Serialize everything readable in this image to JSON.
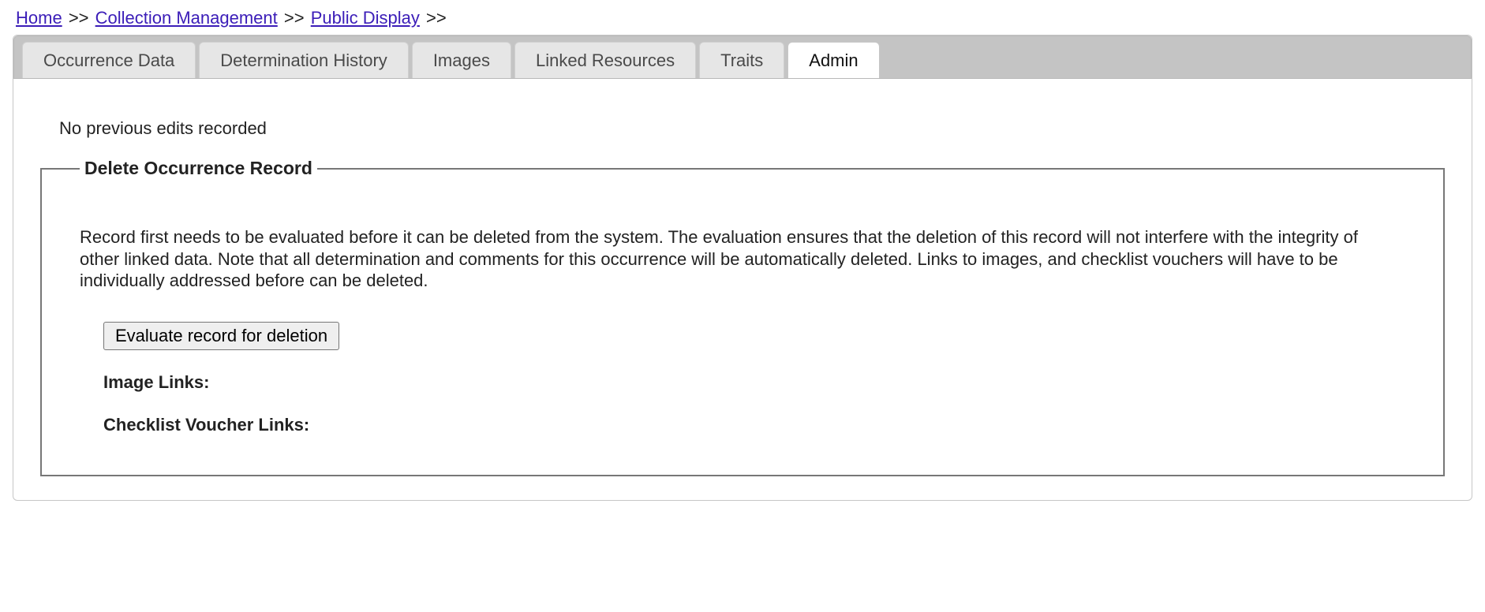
{
  "breadcrumb": {
    "home": "Home",
    "collection_management": "Collection Management",
    "public_display": "Public Display",
    "sep": ">>"
  },
  "tabs": {
    "occurrence_data": "Occurrence Data",
    "determination_history": "Determination History",
    "images": "Images",
    "linked_resources": "Linked Resources",
    "traits": "Traits",
    "admin": "Admin"
  },
  "admin_panel": {
    "no_edits": "No previous edits recorded",
    "fieldset_legend": "Delete Occurrence Record",
    "description": "Record first needs to be evaluated before it can be deleted from the system. The evaluation ensures that the deletion of this record will not interfere with the integrity of other linked data. Note that all determination and comments for this occurrence will be automatically deleted. Links to images, and checklist vouchers will have to be individually addressed before can be deleted.",
    "evaluate_button": "Evaluate record for deletion",
    "image_links_label": "Image Links:",
    "checklist_voucher_links_label": "Checklist Voucher Links:"
  }
}
